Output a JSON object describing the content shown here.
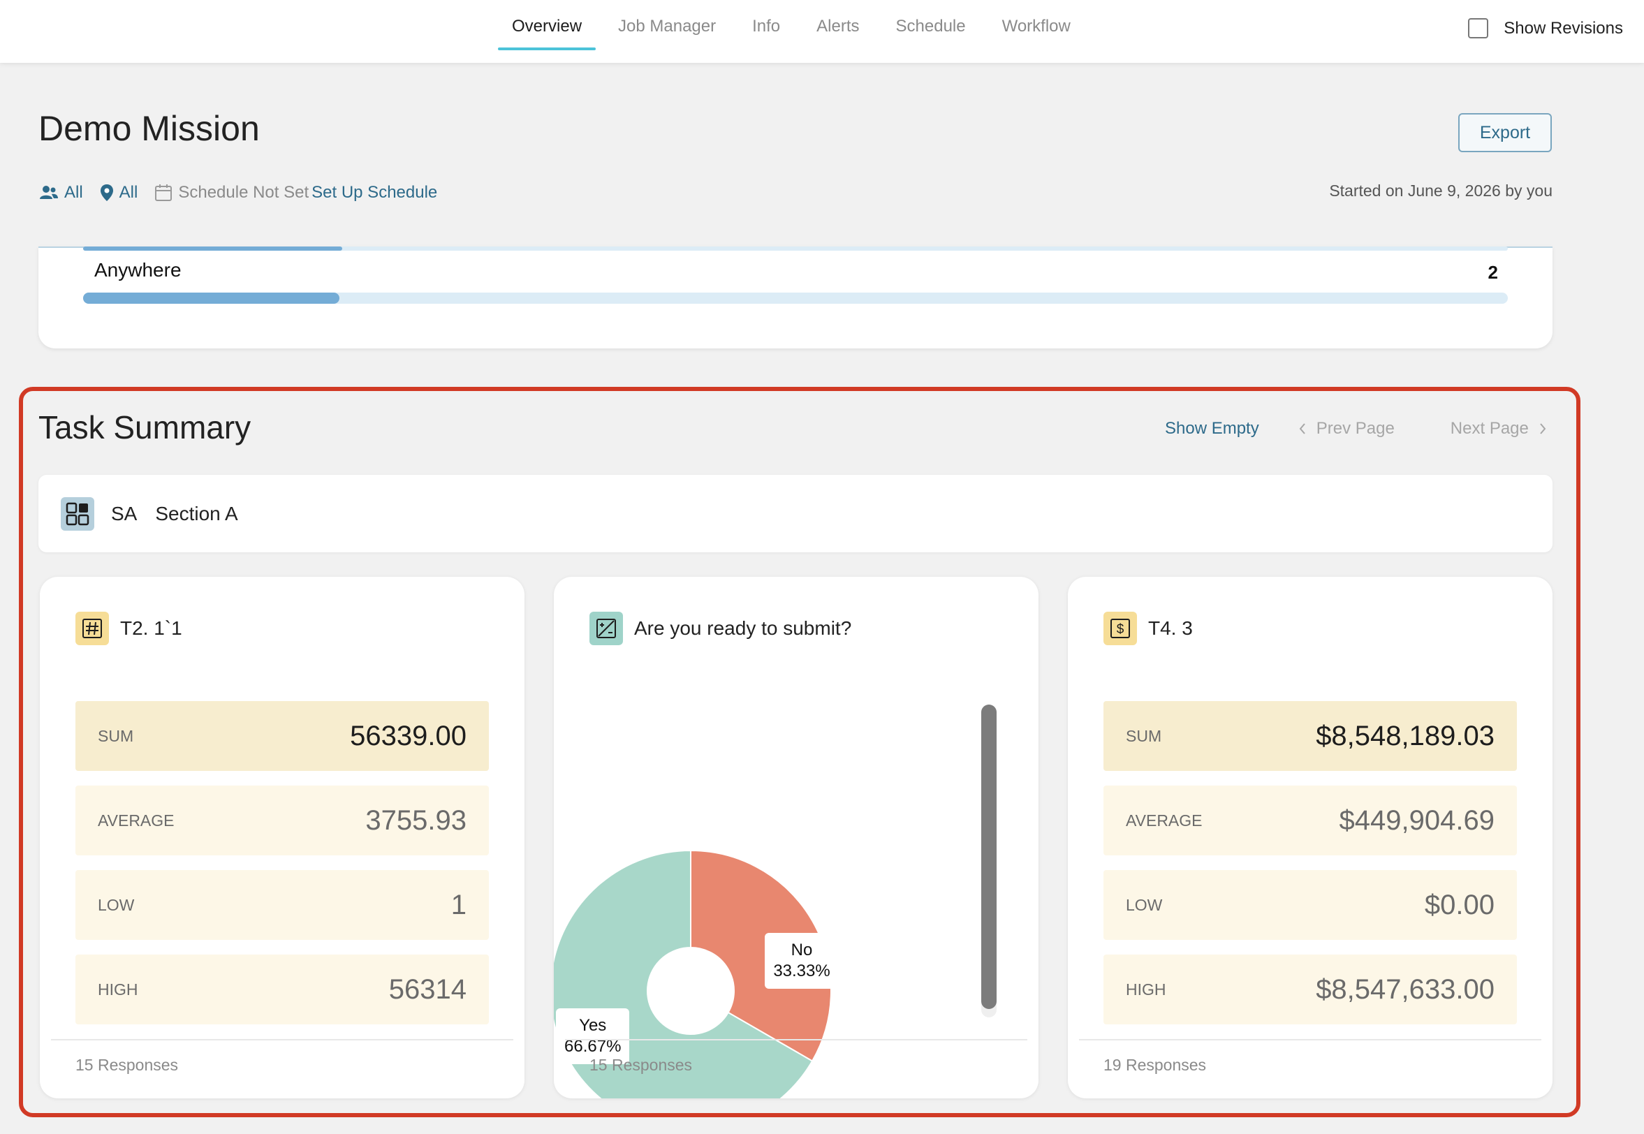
{
  "nav": {
    "tabs": [
      "Overview",
      "Job Manager",
      "Info",
      "Alerts",
      "Schedule",
      "Workflow"
    ],
    "active": "Overview",
    "show_revisions_label": "Show Revisions"
  },
  "header": {
    "title": "Demo Mission",
    "export_label": "Export",
    "users_filter": "All",
    "location_filter": "All",
    "schedule_status": "Schedule Not Set",
    "schedule_link": "Set Up Schedule",
    "started_text": "Started on June 9, 2026 by you"
  },
  "location_card": {
    "row_label": "Anywhere",
    "row_count": "2",
    "bar_fraction": 0.18
  },
  "task_summary": {
    "title": "Task Summary",
    "show_empty": "Show Empty",
    "prev_page": "Prev Page",
    "next_page": "Next Page",
    "section": {
      "code": "SA",
      "name": "Section A"
    },
    "cards": [
      {
        "title": "T2. 1`1",
        "icon": "hash-icon",
        "stats": [
          {
            "label": "SUM",
            "value": "56339.00"
          },
          {
            "label": "AVERAGE",
            "value": "3755.93"
          },
          {
            "label": "LOW",
            "value": "1"
          },
          {
            "label": "HIGH",
            "value": "56314"
          }
        ],
        "responses": "15 Responses"
      },
      {
        "title": "Are you ready to submit?",
        "icon": "yes-no-icon",
        "responses": "15 Responses"
      },
      {
        "title": "T4. 3",
        "icon": "dollar-icon",
        "stats": [
          {
            "label": "SUM",
            "value": "$8,548,189.03"
          },
          {
            "label": "AVERAGE",
            "value": "$449,904.69"
          },
          {
            "label": "LOW",
            "value": "$0.00"
          },
          {
            "label": "HIGH",
            "value": "$8,547,633.00"
          }
        ],
        "responses": "19 Responses"
      }
    ]
  },
  "chart_data": {
    "type": "pie",
    "title": "",
    "categories": [
      "No",
      "Yes"
    ],
    "values": [
      33.33,
      66.67
    ],
    "labels": [
      "33.33%",
      "66.67%"
    ],
    "colors": [
      "#e8876f",
      "#a8d7c9"
    ],
    "donut": true
  },
  "colors": {
    "accent": "#4cc3d9",
    "link": "#2d6a8a",
    "highlight": "#d13a25",
    "sum_bg": "#f7edcf",
    "stat_bg": "#fdf7e7"
  }
}
